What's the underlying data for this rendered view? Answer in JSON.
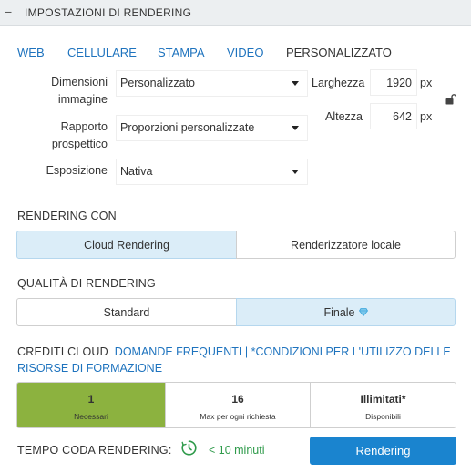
{
  "header": {
    "collapse_symbol": "−",
    "title": "IMPOSTAZIONI DI RENDERING"
  },
  "preset_tabs": [
    {
      "label": "WEB",
      "active": false
    },
    {
      "label": "CELLULARE",
      "active": false
    },
    {
      "label": "STAMPA",
      "active": false
    },
    {
      "label": "VIDEO",
      "active": false
    },
    {
      "label": "PERSONALIZZATO",
      "active": true
    }
  ],
  "image_settings": {
    "dimensions_label": "Dimensioni immagine",
    "dimensions_value": "Personalizzato",
    "ratio_label": "Rapporto prospettico",
    "ratio_value": "Proporzioni personalizzate",
    "exposure_label": "Esposizione",
    "exposure_value": "Nativa",
    "width_label": "Larghezza",
    "width_value": "1920",
    "height_label": "Altezza",
    "height_value": "642",
    "unit": "px"
  },
  "render_with": {
    "title": "RENDERING CON",
    "options": [
      "Cloud Rendering",
      "Renderizzatore locale"
    ],
    "selected": "Cloud Rendering"
  },
  "quality": {
    "title": "QUALITÀ DI RENDERING",
    "options": [
      "Standard",
      "Finale"
    ],
    "selected": "Finale"
  },
  "credits": {
    "label": "CREDITI CLOUD",
    "faq_link": "DOMANDE FREQUENTI",
    "separator": "|",
    "terms_link": "*CONDIZIONI PER L'UTILIZZO DELLE RISORSE DI FORMAZIONE",
    "cells": [
      {
        "value": "1",
        "caption": "Necessari"
      },
      {
        "value": "16",
        "caption": "Max per ogni richiesta"
      },
      {
        "value": "Illimitati*",
        "caption": "Disponibili"
      }
    ]
  },
  "queue": {
    "label": "TEMPO CODA RENDERING:",
    "time": "< 10 minuti",
    "timer_icon": "timer-icon"
  },
  "render_button": "Rendering",
  "colors": {
    "link": "#1e73be",
    "selected_bg": "#dbedf8",
    "credit_green": "#8cb23f",
    "queue_green": "#2e9a4a",
    "button_blue": "#1a84cf",
    "header_bg": "#eceff1"
  }
}
